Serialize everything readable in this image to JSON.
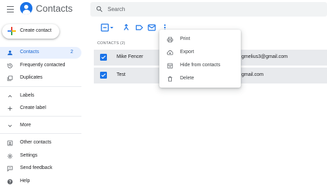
{
  "app": {
    "title": "Contacts"
  },
  "search": {
    "placeholder": "Search"
  },
  "sidebar": {
    "create_label": "Create contact",
    "items": [
      {
        "label": "Contacts",
        "count": "2",
        "icon": "person-icon"
      },
      {
        "label": "Frequently contacted",
        "icon": "history-icon"
      },
      {
        "label": "Duplicates",
        "icon": "duplicates-icon"
      },
      {
        "label": "Labels",
        "icon": "chevron-up-icon"
      },
      {
        "label": "Create label",
        "icon": "plus-icon"
      },
      {
        "label": "More",
        "icon": "chevron-down-icon"
      },
      {
        "label": "Other contacts",
        "icon": "other-contacts-icon"
      },
      {
        "label": "Settings",
        "icon": "gear-icon"
      },
      {
        "label": "Send feedback",
        "icon": "feedback-icon"
      },
      {
        "label": "Help",
        "icon": "help-icon"
      }
    ]
  },
  "list": {
    "header": "CONTACTS (2)",
    "rows": [
      {
        "name": "Mike Fencer",
        "email": "gmelius3@gmail.com",
        "checked": true
      },
      {
        "name": "Test",
        "email": "gmail.com",
        "checked": true
      }
    ]
  },
  "menu": {
    "items": [
      {
        "label": "Print",
        "icon": "print-icon"
      },
      {
        "label": "Export",
        "icon": "cloud-download-icon"
      },
      {
        "label": "Hide from contacts",
        "icon": "archive-icon"
      },
      {
        "label": "Delete",
        "icon": "trash-icon"
      }
    ]
  },
  "colors": {
    "accent": "#1a73e8",
    "active_bg": "#e8f0fe",
    "row_selected_bg": "#e8eaed"
  }
}
